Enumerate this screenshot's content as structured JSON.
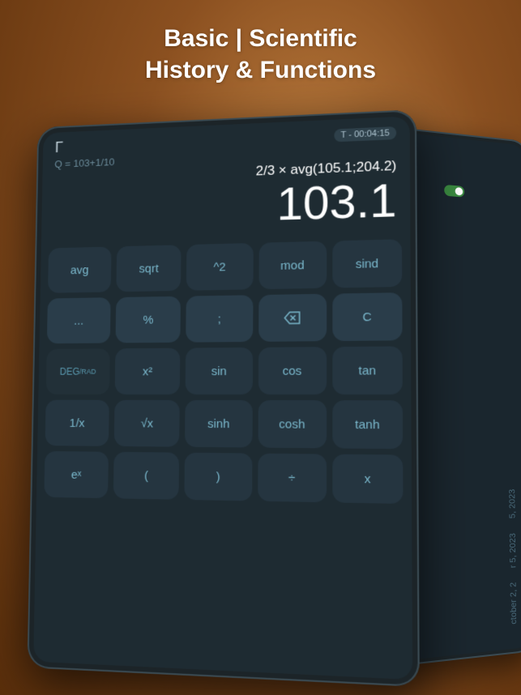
{
  "header": {
    "line1": "Basic | Scientific",
    "line2": "History & Functions"
  },
  "tablet": {
    "timer": "T - 00:04:15",
    "corner": "Γ",
    "history_line": "Q = 103+1/10",
    "expression": "2/3 × avg(105.1;204.2)",
    "result": "103.1",
    "keypad": [
      [
        {
          "label": "avg",
          "type": "dark"
        },
        {
          "label": "sqrt",
          "type": "dark"
        },
        {
          "label": "^2",
          "type": "dark"
        },
        {
          "label": "mod",
          "type": "dark"
        },
        {
          "label": "sind",
          "type": "dark"
        }
      ],
      [
        {
          "label": "...",
          "type": "mid"
        },
        {
          "label": "%",
          "type": "mid"
        },
        {
          "label": ";",
          "type": "mid"
        },
        {
          "label": "⌫",
          "type": "mid",
          "is_back": true
        },
        {
          "label": "C",
          "type": "mid"
        }
      ],
      [
        {
          "label": "DEG/RAD",
          "type": "special",
          "is_deg": true
        },
        {
          "label": "x²",
          "type": "dark"
        },
        {
          "label": "sin",
          "type": "dark"
        },
        {
          "label": "cos",
          "type": "dark"
        },
        {
          "label": "tan",
          "type": "dark"
        }
      ],
      [
        {
          "label": "1/x",
          "type": "dark"
        },
        {
          "label": "√x",
          "type": "dark"
        },
        {
          "label": "sinh",
          "type": "dark"
        },
        {
          "label": "cosh",
          "type": "dark"
        },
        {
          "label": "tanh",
          "type": "dark"
        }
      ],
      [
        {
          "label": "eˣ",
          "type": "dark"
        },
        {
          "label": "(",
          "type": "dark"
        },
        {
          "label": ")",
          "type": "dark"
        },
        {
          "label": "÷",
          "type": "dark"
        },
        {
          "label": "x",
          "type": "dark"
        }
      ]
    ]
  },
  "secondary": {
    "dates": [
      "5, 2023",
      "r 5, 2023",
      "ctober 2, 2"
    ]
  }
}
